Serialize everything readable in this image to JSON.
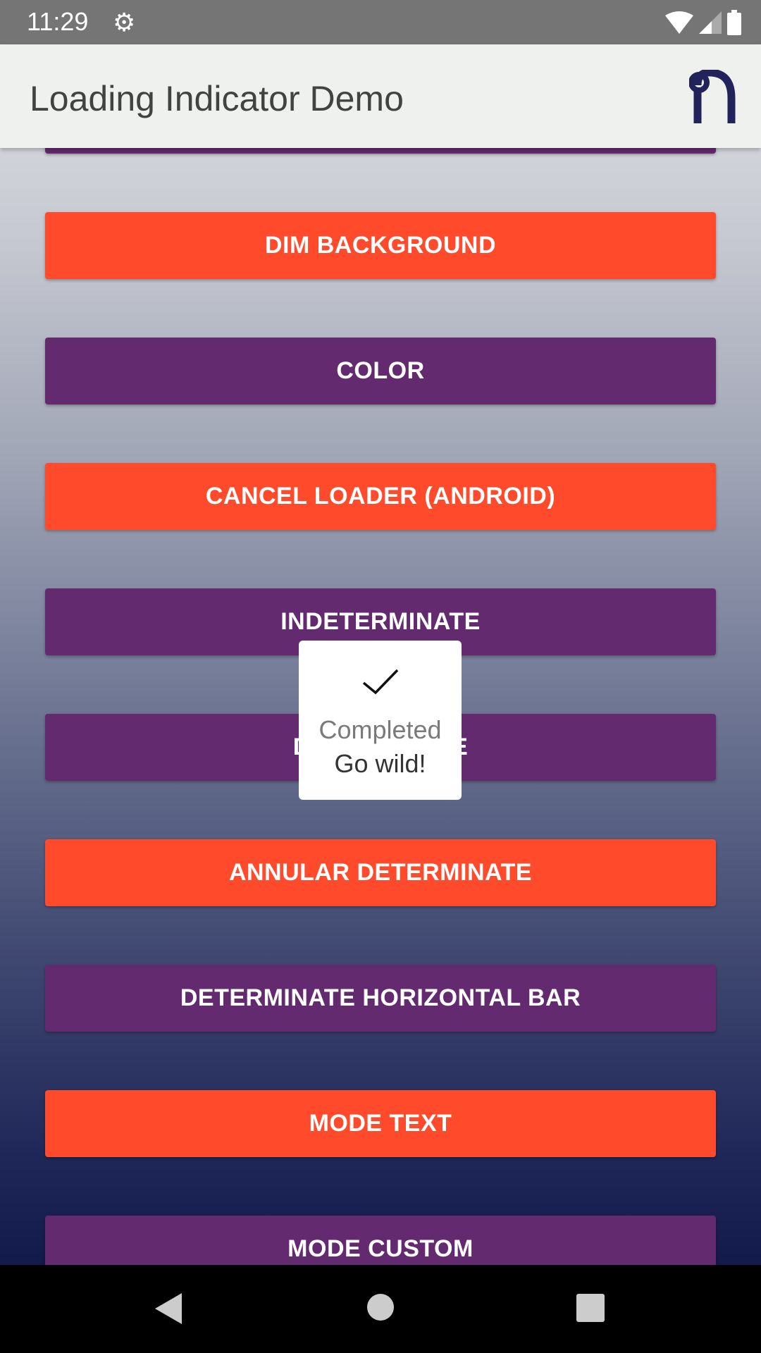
{
  "status_bar": {
    "time": "11:29"
  },
  "app_bar": {
    "title": "Loading Indicator Demo"
  },
  "buttons": [
    {
      "label": "",
      "color": "purple"
    },
    {
      "label": "DIM BACKGROUND",
      "color": "orange"
    },
    {
      "label": "COLOR",
      "color": "purple"
    },
    {
      "label": "CANCEL LOADER (ANDROID)",
      "color": "orange"
    },
    {
      "label": "INDETERMINATE",
      "color": "purple"
    },
    {
      "label": "DETERMINATE",
      "color": "purple"
    },
    {
      "label": "ANNULAR DETERMINATE",
      "color": "orange"
    },
    {
      "label": "DETERMINATE HORIZONTAL BAR",
      "color": "purple"
    },
    {
      "label": "MODE TEXT",
      "color": "orange"
    },
    {
      "label": "MODE CUSTOM",
      "color": "purple"
    }
  ],
  "toast": {
    "title": "Completed",
    "message": "Go wild!"
  },
  "colors": {
    "orange": "#ff4b2b",
    "purple": "#642a6f",
    "appbar": "#eff1ef"
  }
}
